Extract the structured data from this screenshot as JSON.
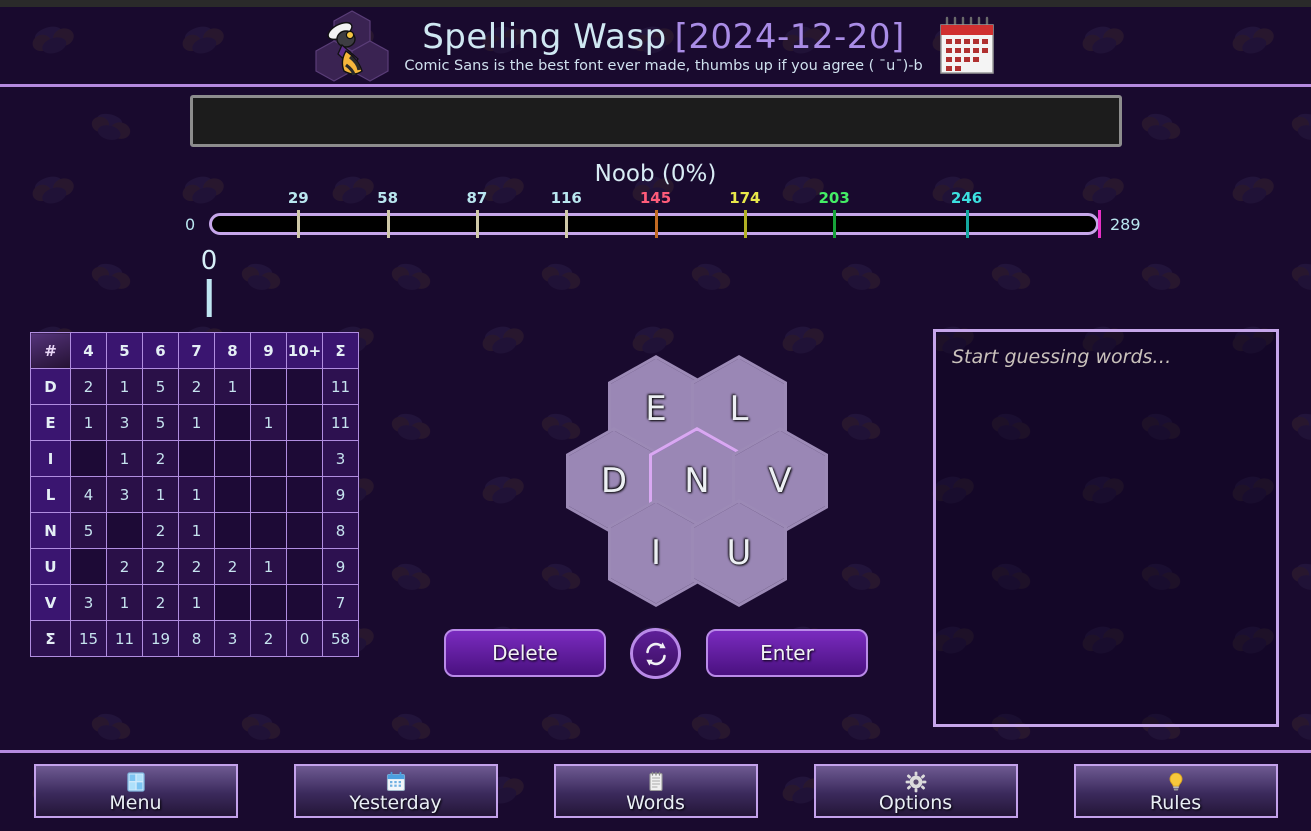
{
  "header": {
    "title_name": "Spelling Wasp",
    "title_date": "[2024-12-20]",
    "subtitle": "Comic Sans is the best font ever made, thumbs up if you agree ( ˉuˉ)-b",
    "logo_icon": "wasp-logo-icon",
    "calendar_icon": "calendar-icon"
  },
  "guess": {
    "value": "",
    "placeholder": ""
  },
  "rank": {
    "label": "Noob (0%)",
    "name": "Noob",
    "percent": 0
  },
  "progress": {
    "min_label": "0",
    "max_label": "289",
    "min": 0,
    "max": 289,
    "current_score": "0",
    "current_value": 0,
    "end_tick_color": "#e830c8",
    "ticks": [
      {
        "label": "29",
        "value": 29,
        "text_color": "#b9e6ef",
        "line_color": "#cfc9a8"
      },
      {
        "label": "58",
        "value": 58,
        "text_color": "#b9e6ef",
        "line_color": "#cfc9a8"
      },
      {
        "label": "87",
        "value": 87,
        "text_color": "#b9e6ef",
        "line_color": "#cfc9a8"
      },
      {
        "label": "116",
        "value": 116,
        "text_color": "#b9e6ef",
        "line_color": "#cfc9a8"
      },
      {
        "label": "145",
        "value": 145,
        "text_color": "#ff5c7a",
        "line_color": "#c26a22"
      },
      {
        "label": "174",
        "value": 174,
        "text_color": "#e8e84a",
        "line_color": "#b0b024"
      },
      {
        "label": "203",
        "value": 203,
        "text_color": "#44ee66",
        "line_color": "#17a33a"
      },
      {
        "label": "246",
        "value": 246,
        "text_color": "#3ce0e0",
        "line_color": "#14a8a0"
      }
    ]
  },
  "stats_table": {
    "corner": "#",
    "columns": [
      "4",
      "5",
      "6",
      "7",
      "8",
      "9",
      "10+",
      "Σ"
    ],
    "rows": [
      {
        "letter": "D",
        "cells": [
          "2",
          "1",
          "5",
          "2",
          "1",
          "",
          "",
          "11"
        ]
      },
      {
        "letter": "E",
        "cells": [
          "1",
          "3",
          "5",
          "1",
          "",
          "1",
          "",
          "11"
        ]
      },
      {
        "letter": "I",
        "cells": [
          "",
          "1",
          "2",
          "",
          "",
          "",
          "",
          "3"
        ]
      },
      {
        "letter": "L",
        "cells": [
          "4",
          "3",
          "1",
          "1",
          "",
          "",
          "",
          "9"
        ]
      },
      {
        "letter": "N",
        "cells": [
          "5",
          "",
          "2",
          "1",
          "",
          "",
          "",
          "8"
        ]
      },
      {
        "letter": "U",
        "cells": [
          "",
          "2",
          "2",
          "2",
          "2",
          "1",
          "",
          "9"
        ]
      },
      {
        "letter": "V",
        "cells": [
          "3",
          "1",
          "2",
          "1",
          "",
          "",
          "",
          "7"
        ]
      }
    ],
    "totals": {
      "letter": "Σ",
      "cells": [
        "15",
        "11",
        "19",
        "8",
        "3",
        "2",
        "0",
        "58"
      ]
    }
  },
  "hive": {
    "center_letter": "N",
    "outer_letters": [
      "E",
      "L",
      "D",
      "V",
      "I",
      "U"
    ],
    "center_color": "#8a2fd4"
  },
  "actions": {
    "delete_label": "Delete",
    "enter_label": "Enter",
    "shuffle_icon": "shuffle-refresh-icon"
  },
  "word_list": {
    "placeholder": "Start guessing words…",
    "words": []
  },
  "footer": {
    "buttons": [
      {
        "label": "Menu",
        "icon": "window-panels-icon"
      },
      {
        "label": "Yesterday",
        "icon": "calendar-icon"
      },
      {
        "label": "Words",
        "icon": "notepad-icon"
      },
      {
        "label": "Options",
        "icon": "gear-icon"
      },
      {
        "label": "Rules",
        "icon": "lightbulb-icon"
      }
    ]
  },
  "theme": {
    "background": "#190a2e",
    "accent_purple": "#b58ae0",
    "text_light": "#cfe8f2"
  }
}
